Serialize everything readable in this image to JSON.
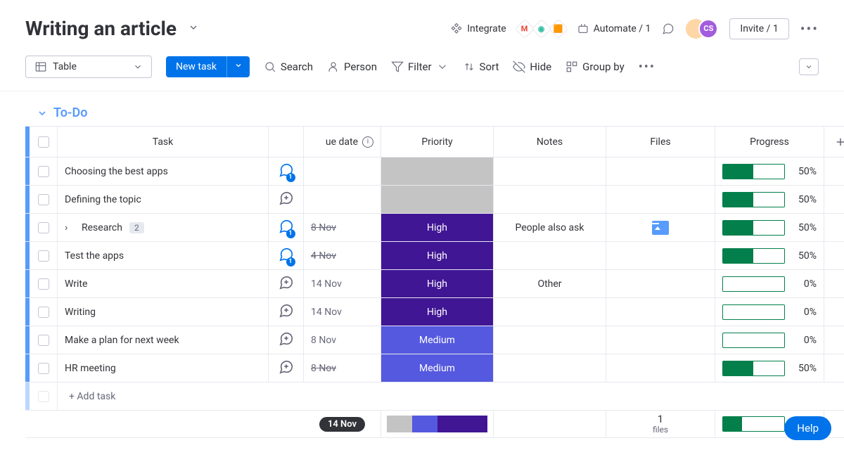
{
  "header": {
    "board_title": "Writing an article",
    "integrate": "Integrate",
    "automate": "Automate / 1",
    "invite": "Invite / 1",
    "member_initials": "CS"
  },
  "toolbar": {
    "view_label": "Table",
    "new_task": "New task",
    "search": "Search",
    "person": "Person",
    "filter": "Filter",
    "sort": "Sort",
    "hide": "Hide",
    "group_by": "Group by"
  },
  "group": {
    "name": "To-Do"
  },
  "columns": {
    "task": "Task",
    "due": "ue date",
    "priority": "Priority",
    "notes": "Notes",
    "files": "Files",
    "progress": "Progress"
  },
  "priority_colors": {
    "High": "#401694",
    "Medium": "#5559df",
    "none": "#c4c4c4"
  },
  "rows": [
    {
      "task": "Choosing the best apps",
      "conv": 1,
      "due": "",
      "due_strike": false,
      "priority": "",
      "notes": "",
      "file": false,
      "progress": 50
    },
    {
      "task": "Defining the topic",
      "conv": 0,
      "due": "",
      "due_strike": false,
      "priority": "",
      "notes": "",
      "file": false,
      "progress": 50
    },
    {
      "task": "Research",
      "sub": 2,
      "conv": 1,
      "due": "8 Nov",
      "due_strike": true,
      "priority": "High",
      "notes": "People also ask",
      "file": true,
      "progress": 50,
      "expandable": true
    },
    {
      "task": "Test the apps",
      "conv": 1,
      "due": "4 Nov",
      "due_strike": true,
      "priority": "High",
      "notes": "",
      "file": false,
      "progress": 50
    },
    {
      "task": "Write",
      "conv": 0,
      "due": "14 Nov",
      "due_strike": false,
      "priority": "High",
      "notes": "Other",
      "file": false,
      "progress": 0
    },
    {
      "task": "Writing",
      "conv": 0,
      "due": "14 Nov",
      "due_strike": false,
      "priority": "High",
      "notes": "",
      "file": false,
      "progress": 0
    },
    {
      "task": "Make a plan for next week",
      "conv": 0,
      "due": "8 Nov",
      "due_strike": false,
      "priority": "Medium",
      "notes": "",
      "file": false,
      "progress": 0
    },
    {
      "task": "HR meeting",
      "conv": 0,
      "due": "8 Nov",
      "due_strike": true,
      "priority": "Medium",
      "notes": "",
      "file": false,
      "progress": 50
    }
  ],
  "add_task": "+ Add task",
  "footer": {
    "due_chip": "14 Nov",
    "priority_dist": [
      {
        "color": "#c4c4c4",
        "pct": 25
      },
      {
        "color": "#5559df",
        "pct": 25
      },
      {
        "color": "#401694",
        "pct": 50
      }
    ],
    "files_count": "1",
    "files_label": "files",
    "progress": 31
  },
  "help": "Help"
}
